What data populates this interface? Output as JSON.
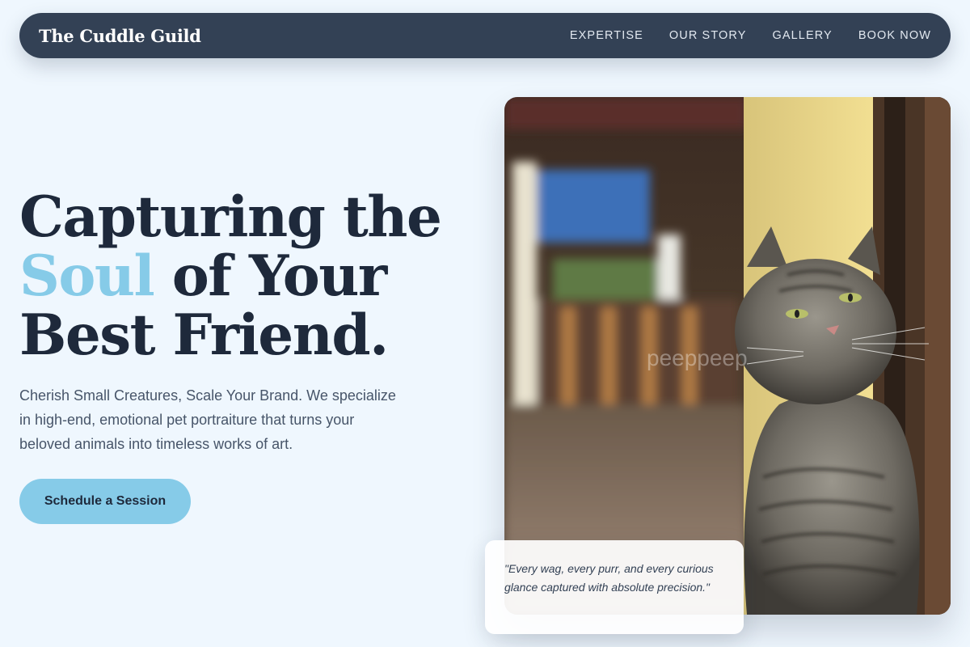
{
  "brand": {
    "name": "The Cuddle Guild"
  },
  "nav": {
    "links": [
      {
        "label": "EXPERTISE"
      },
      {
        "label": "OUR STORY"
      },
      {
        "label": "GALLERY"
      },
      {
        "label": "BOOK NOW"
      }
    ]
  },
  "hero": {
    "title_line1": "Capturing the",
    "title_accent": "Soul",
    "title_line2_rest": " of Your",
    "title_line3": "Best Friend.",
    "description": "Cherish Small Creatures, Scale Your Brand. We specialize in high-end, emotional pet portraiture that turns your beloved animals into timeless works of art.",
    "cta_label": "Schedule a Session"
  },
  "image": {
    "subject": "tabby cat sitting in sunlight on a porch",
    "watermark": "peeppeep"
  },
  "quote": {
    "text": "\"Every wag, every purr, and every curious glance captured with absolute precision.\""
  },
  "colors": {
    "page_bg": "#eff7fe",
    "nav_bg": "#334155",
    "heading": "#1e293b",
    "accent": "#86cbe8",
    "body_text": "#475569"
  }
}
